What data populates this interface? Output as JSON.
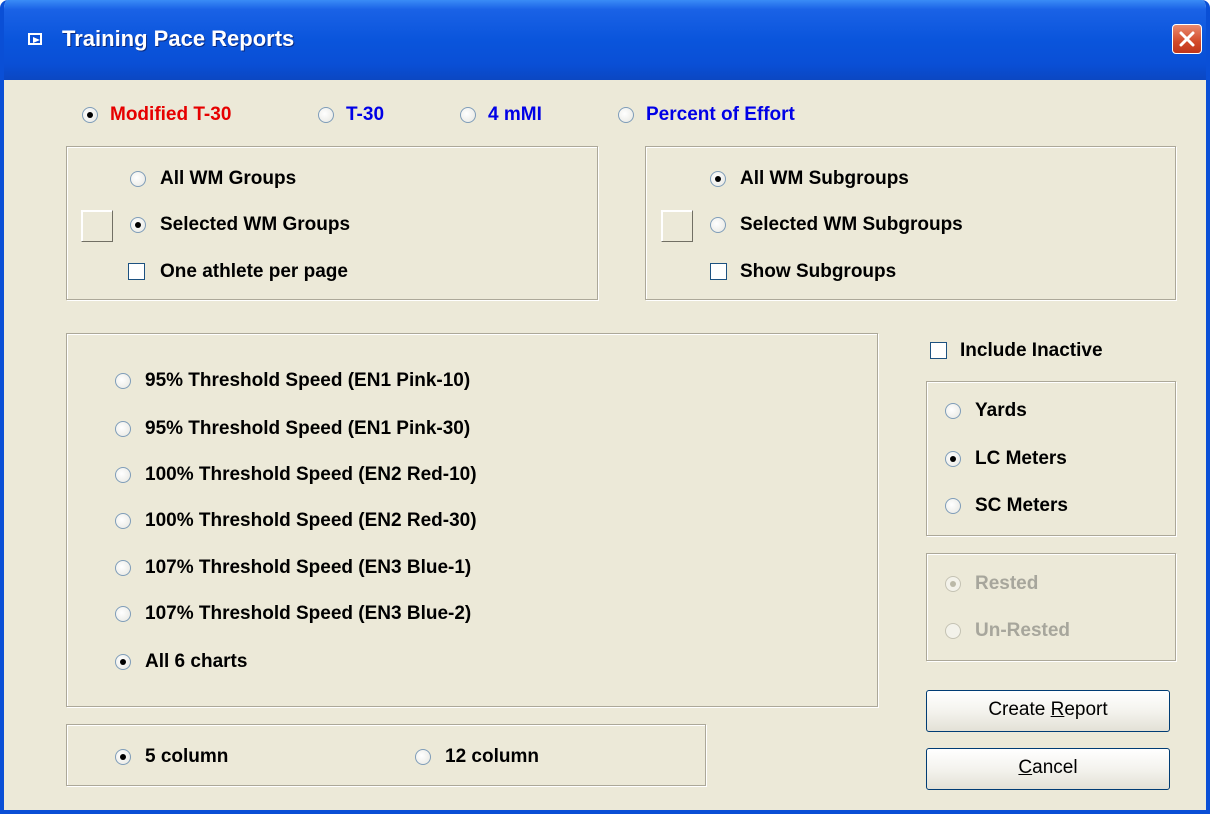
{
  "window": {
    "title": "Training Pace Reports"
  },
  "report_types": [
    {
      "label": "Modified T-30",
      "selected": true,
      "color": "#e60000"
    },
    {
      "label": "T-30",
      "selected": false,
      "color": "#0000e6"
    },
    {
      "label": "4 mMI",
      "selected": false,
      "color": "#0000e6"
    },
    {
      "label": "Percent of Effort",
      "selected": false,
      "color": "#0000e6"
    }
  ],
  "groups": {
    "all_label": "All WM Groups",
    "selected_label": "Selected WM Groups",
    "selected": "selected",
    "one_per_page_label": "One athlete per page",
    "one_per_page_checked": false
  },
  "subgroups": {
    "all_label": "All WM Subgroups",
    "selected_label": "Selected WM Subgroups",
    "selected": "all",
    "show_label": "Show Subgroups",
    "show_checked": false
  },
  "charts": {
    "options": [
      "95% Threshold Speed (EN1 Pink-10)",
      "95% Threshold Speed (EN1 Pink-30)",
      "100% Threshold Speed (EN2 Red-10)",
      "100% Threshold Speed (EN2 Red-30)",
      "107% Threshold Speed (EN3 Blue-1)",
      "107% Threshold Speed (EN3 Blue-2)",
      "All 6 charts"
    ],
    "selected_index": 6
  },
  "columns": {
    "five_label": "5 column",
    "twelve_label": "12 column",
    "selected": "5"
  },
  "include_inactive": {
    "label": "Include Inactive",
    "checked": false
  },
  "units": {
    "options": [
      "Yards",
      "LC Meters",
      "SC Meters"
    ],
    "selected_index": 1
  },
  "rested": {
    "options": [
      "Rested",
      "Un-Rested"
    ],
    "selected_index": 0,
    "disabled": true
  },
  "buttons": {
    "create_pre": "Create ",
    "create_ul": "R",
    "create_post": "eport",
    "cancel_ul": "C",
    "cancel_post": "ancel"
  }
}
